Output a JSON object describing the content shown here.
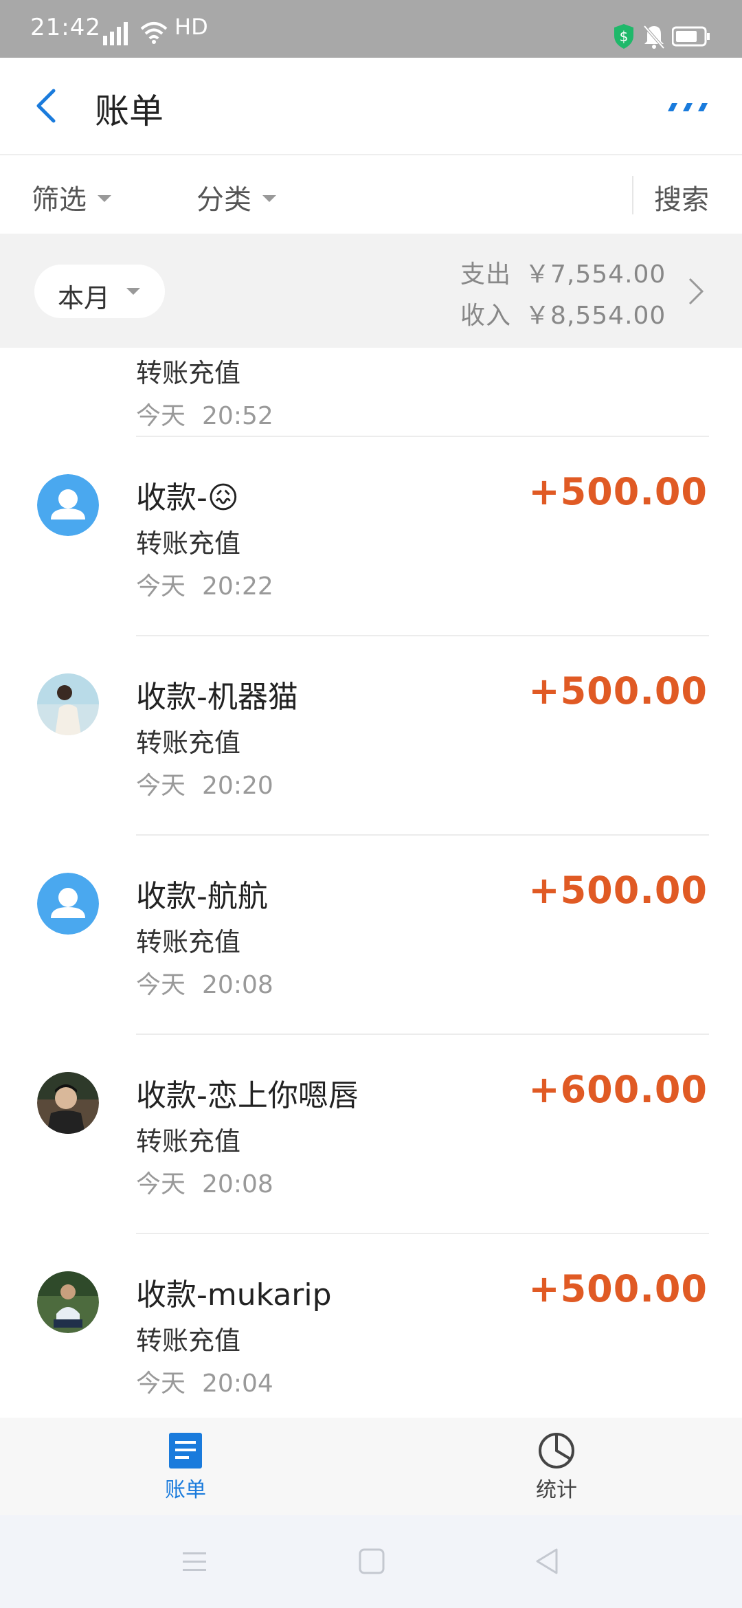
{
  "status_bar": {
    "time": "21:42",
    "network": "HD"
  },
  "header": {
    "title": "账单"
  },
  "filter_bar": {
    "filter_label": "筛选",
    "category_label": "分类",
    "search_label": "搜索"
  },
  "month_summary": {
    "period_label": "本月",
    "expense_label": "支出",
    "expense_value": "￥7,554.00",
    "income_label": "收入",
    "income_value": "￥8,554.00"
  },
  "partial_row": {
    "subtitle": "转账充值",
    "day": "今天",
    "time": "20:52"
  },
  "transactions": [
    {
      "title": "收款-😖",
      "subtitle": "转账充值",
      "day": "今天",
      "time": "20:22",
      "amount": "+500.00",
      "avatar": "default-user-icon"
    },
    {
      "title": "收款-机器猫",
      "subtitle": "转账充值",
      "day": "今天",
      "time": "20:20",
      "amount": "+500.00",
      "avatar": "photo-avatar"
    },
    {
      "title": "收款-航航",
      "subtitle": "转账充值",
      "day": "今天",
      "time": "20:08",
      "amount": "+500.00",
      "avatar": "default-user-icon"
    },
    {
      "title": "收款-恋上你嗯唇",
      "subtitle": "转账充值",
      "day": "今天",
      "time": "20:08",
      "amount": "+600.00",
      "avatar": "photo-avatar"
    },
    {
      "title": "收款-mukarip",
      "subtitle": "转账充值",
      "day": "今天",
      "time": "20:04",
      "amount": "+500.00",
      "avatar": "photo-avatar"
    }
  ],
  "tab_bar": {
    "bill_label": "账单",
    "stats_label": "统计"
  },
  "colors": {
    "accent_blue": "#1a7bdc",
    "income_orange": "#e05a24",
    "avatar_blue": "#4aa8ef"
  }
}
